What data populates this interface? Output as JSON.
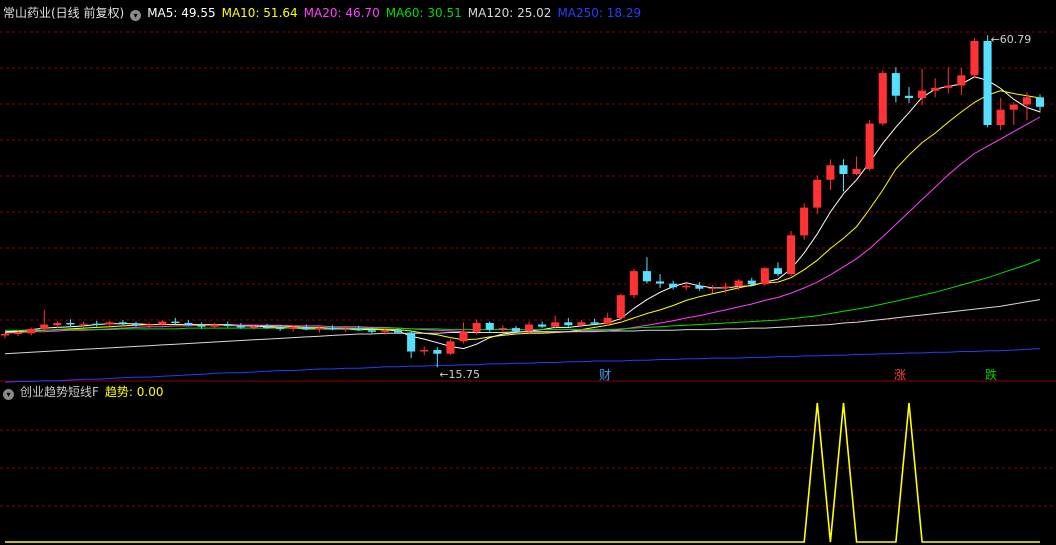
{
  "main_header": {
    "title": "常山药业(日线 前复权)",
    "ma_labels": [
      {
        "text": "MA5: 49.55",
        "color": "#ffffff"
      },
      {
        "text": "MA10: 51.64",
        "color": "#ffff00"
      },
      {
        "text": "MA20: 46.70",
        "color": "#ff40ff"
      },
      {
        "text": "MA60: 30.51",
        "color": "#00e000"
      },
      {
        "text": "MA120: 25.02",
        "color": "#d8d8d8"
      },
      {
        "text": "MA250: 18.29",
        "color": "#2a3cff"
      }
    ]
  },
  "annotations": {
    "high_label": "60.79",
    "low_label": "15.75"
  },
  "event_tags": [
    {
      "text": "财",
      "color": "#3aa0ff"
    },
    {
      "text": "涨",
      "color": "#ff4040"
    },
    {
      "text": "跌",
      "color": "#00d000"
    }
  ],
  "sub_header": {
    "title": "创业趋势短线F",
    "indicator_label": "趋势",
    "indicator_value": ": 0.00"
  },
  "colors": {
    "up": "#ff3333",
    "down": "#55e0ff",
    "grid": "#8b0000",
    "indicator": "#ffff00",
    "background": "#000000"
  },
  "chart_data": {
    "type": "candlestick",
    "price_range": [
      14,
      63
    ],
    "candles": [
      [
        20.1,
        20.5,
        19.7,
        20.3
      ],
      [
        20.3,
        20.8,
        20.0,
        20.5
      ],
      [
        20.4,
        21.2,
        20.1,
        21.0
      ],
      [
        21.0,
        23.6,
        20.8,
        21.6
      ],
      [
        21.5,
        22.0,
        21.1,
        21.8
      ],
      [
        21.8,
        22.3,
        21.4,
        21.6
      ],
      [
        21.6,
        22.0,
        21.2,
        21.7
      ],
      [
        21.7,
        22.1,
        21.3,
        21.6
      ],
      [
        21.6,
        22.1,
        21.3,
        21.9
      ],
      [
        21.9,
        22.2,
        21.5,
        21.7
      ],
      [
        21.7,
        22.0,
        21.3,
        21.5
      ],
      [
        21.5,
        21.9,
        21.1,
        21.6
      ],
      [
        21.6,
        22.2,
        21.4,
        22.0
      ],
      [
        22.0,
        22.5,
        21.6,
        21.8
      ],
      [
        21.8,
        22.2,
        21.4,
        21.5
      ],
      [
        21.5,
        21.9,
        21.0,
        21.3
      ],
      [
        21.3,
        21.8,
        21.0,
        21.6
      ],
      [
        21.6,
        22.0,
        21.2,
        21.4
      ],
      [
        21.4,
        21.8,
        21.0,
        21.2
      ],
      [
        21.2,
        21.6,
        20.9,
        21.3
      ],
      [
        21.3,
        21.7,
        21.0,
        21.1
      ],
      [
        21.1,
        21.5,
        20.7,
        21.0
      ],
      [
        21.0,
        21.4,
        20.6,
        21.2
      ],
      [
        21.2,
        21.6,
        20.8,
        20.9
      ],
      [
        20.9,
        21.3,
        20.5,
        21.1
      ],
      [
        21.1,
        21.5,
        20.8,
        20.9
      ],
      [
        20.9,
        21.3,
        20.6,
        21.0
      ],
      [
        21.0,
        21.4,
        20.7,
        20.8
      ],
      [
        20.8,
        21.2,
        20.4,
        20.6
      ],
      [
        20.6,
        21.0,
        20.2,
        20.8
      ],
      [
        20.8,
        21.1,
        20.4,
        20.5
      ],
      [
        20.5,
        20.7,
        17.0,
        17.9
      ],
      [
        17.9,
        18.6,
        17.4,
        18.1
      ],
      [
        18.1,
        18.5,
        15.75,
        17.6
      ],
      [
        17.6,
        19.6,
        17.4,
        19.3
      ],
      [
        19.3,
        21.9,
        19.0,
        20.6
      ],
      [
        20.6,
        22.3,
        20.2,
        21.8
      ],
      [
        21.8,
        22.0,
        20.6,
        20.9
      ],
      [
        20.9,
        21.5,
        20.5,
        21.1
      ],
      [
        21.1,
        21.4,
        20.5,
        20.7
      ],
      [
        20.7,
        22.0,
        20.4,
        21.6
      ],
      [
        21.6,
        22.0,
        21.1,
        21.3
      ],
      [
        21.3,
        22.8,
        21.0,
        21.9
      ],
      [
        21.9,
        22.5,
        21.3,
        21.5
      ],
      [
        21.5,
        22.2,
        21.2,
        21.9
      ],
      [
        21.9,
        22.4,
        21.5,
        21.7
      ],
      [
        21.7,
        23.2,
        21.4,
        22.5
      ],
      [
        22.5,
        25.8,
        22.2,
        25.6
      ],
      [
        25.6,
        29.2,
        25.2,
        28.9
      ],
      [
        28.9,
        30.8,
        27.2,
        27.5
      ],
      [
        27.5,
        28.5,
        26.6,
        27.2
      ],
      [
        27.2,
        27.6,
        26.4,
        26.7
      ],
      [
        26.7,
        27.3,
        26.3,
        26.9
      ],
      [
        26.9,
        27.4,
        26.2,
        26.5
      ],
      [
        26.5,
        27.0,
        25.9,
        26.6
      ],
      [
        26.6,
        27.3,
        25.9,
        26.8
      ],
      [
        26.8,
        27.8,
        26.3,
        27.6
      ],
      [
        27.6,
        28.0,
        26.9,
        27.1
      ],
      [
        27.1,
        29.5,
        26.9,
        29.3
      ],
      [
        29.3,
        30.1,
        28.2,
        28.5
      ],
      [
        28.5,
        34.4,
        28.2,
        33.8
      ],
      [
        33.8,
        38.2,
        33.2,
        37.6
      ],
      [
        37.6,
        42.0,
        36.7,
        41.4
      ],
      [
        41.4,
        44.2,
        40.0,
        43.4
      ],
      [
        43.4,
        44.2,
        39.8,
        42.2
      ],
      [
        42.2,
        44.6,
        42.0,
        42.9
      ],
      [
        42.9,
        49.6,
        42.6,
        49.1
      ],
      [
        49.1,
        56.4,
        48.8,
        56.0
      ],
      [
        56.0,
        56.8,
        52.0,
        52.9
      ],
      [
        52.9,
        54.1,
        51.9,
        52.6
      ],
      [
        52.6,
        56.6,
        51.6,
        53.6
      ],
      [
        53.6,
        55.3,
        52.7,
        54.0
      ],
      [
        54.0,
        56.8,
        53.2,
        54.3
      ],
      [
        54.3,
        56.7,
        53.0,
        55.7
      ],
      [
        55.7,
        60.79,
        55.3,
        60.4
      ],
      [
        60.4,
        61.2,
        48.6,
        48.9
      ],
      [
        48.9,
        52.6,
        48.2,
        51.0
      ],
      [
        51.0,
        52.0,
        48.9,
        51.7
      ],
      [
        51.7,
        53.4,
        49.6,
        52.7
      ],
      [
        52.7,
        53.1,
        50.6,
        51.4
      ]
    ],
    "ma_lines": [
      {
        "name": "MA5",
        "color": "#ffffff",
        "values": [
          20.6,
          20.7,
          20.9,
          21.1,
          21.2,
          21.3,
          21.4,
          21.6,
          21.7,
          21.7,
          21.7,
          21.6,
          21.6,
          21.6,
          21.6,
          21.6,
          21.6,
          21.5,
          21.4,
          21.4,
          21.3,
          21.2,
          21.1,
          21.0,
          21.0,
          21.0,
          21.0,
          20.9,
          20.9,
          20.9,
          20.7,
          20.0,
          19.6,
          19.1,
          18.6,
          18.3,
          18.9,
          19.8,
          20.3,
          20.5,
          20.7,
          20.9,
          21.2,
          21.2,
          21.4,
          21.6,
          21.8,
          22.4,
          23.8,
          25.0,
          26.0,
          26.8,
          27.3,
          26.9,
          26.6,
          26.6,
          26.8,
          26.9,
          27.4,
          27.8,
          29.2,
          31.4,
          34.0,
          37.0,
          39.5,
          41.4,
          43.8,
          46.4,
          48.6,
          50.6,
          52.7,
          53.8,
          54.2,
          54.5,
          55.5,
          55.0,
          53.9,
          52.4,
          51.3,
          50.7
        ]
      },
      {
        "name": "MA10",
        "color": "#ffff00",
        "values": [
          20.5,
          20.6,
          20.7,
          20.8,
          20.9,
          21.0,
          21.1,
          21.2,
          21.3,
          21.4,
          21.5,
          21.6,
          21.6,
          21.6,
          21.6,
          21.6,
          21.6,
          21.6,
          21.5,
          21.5,
          21.4,
          21.4,
          21.3,
          21.2,
          21.2,
          21.1,
          21.1,
          21.0,
          21.0,
          20.9,
          20.9,
          20.7,
          20.4,
          20.2,
          19.8,
          19.5,
          19.6,
          19.9,
          20.1,
          20.3,
          20.4,
          20.4,
          20.5,
          20.6,
          20.9,
          21.2,
          21.5,
          21.9,
          22.5,
          23.1,
          23.6,
          24.2,
          24.9,
          25.4,
          25.8,
          26.2,
          26.6,
          27.0,
          27.3,
          27.4,
          28.0,
          29.1,
          30.4,
          32.0,
          33.4,
          35.0,
          37.4,
          40.0,
          42.9,
          44.8,
          46.5,
          47.8,
          49.3,
          50.7,
          52.0,
          53.0,
          53.6,
          53.2,
          52.9,
          52.6
        ]
      },
      {
        "name": "MA20",
        "color": "#ff40ff",
        "values": [
          20.4,
          20.5,
          20.6,
          20.6,
          20.7,
          20.8,
          20.8,
          20.9,
          21.0,
          21.1,
          21.2,
          21.3,
          21.3,
          21.4,
          21.4,
          21.5,
          21.5,
          21.5,
          21.5,
          21.5,
          21.5,
          21.5,
          21.4,
          21.4,
          21.4,
          21.3,
          21.3,
          21.3,
          21.2,
          21.2,
          21.1,
          21.0,
          20.9,
          20.8,
          20.7,
          20.6,
          20.5,
          20.5,
          20.5,
          20.6,
          20.6,
          20.6,
          20.6,
          20.6,
          20.6,
          20.6,
          20.7,
          20.9,
          21.2,
          21.5,
          21.8,
          22.1,
          22.5,
          22.8,
          23.2,
          23.6,
          24.0,
          24.4,
          24.9,
          25.3,
          25.9,
          26.6,
          27.4,
          28.4,
          29.5,
          30.6,
          32.0,
          33.6,
          35.3,
          37.0,
          38.7,
          40.4,
          42.1,
          43.6,
          45.0,
          46.0,
          47.0,
          48.0,
          49.0,
          50.0
        ]
      },
      {
        "name": "MA60",
        "color": "#00e000",
        "values": [
          20.8,
          20.8,
          20.8,
          20.8,
          20.9,
          20.9,
          20.9,
          20.9,
          20.9,
          21.0,
          21.0,
          21.0,
          21.0,
          21.0,
          21.1,
          21.1,
          21.1,
          21.1,
          21.1,
          21.1,
          21.1,
          21.1,
          21.1,
          21.1,
          21.1,
          21.1,
          21.1,
          21.1,
          21.1,
          21.1,
          21.1,
          21.0,
          21.0,
          21.0,
          20.9,
          20.9,
          20.9,
          20.9,
          20.9,
          20.9,
          20.9,
          20.9,
          20.9,
          20.9,
          20.9,
          20.9,
          20.9,
          21.0,
          21.1,
          21.2,
          21.3,
          21.4,
          21.5,
          21.6,
          21.7,
          21.8,
          21.9,
          22.0,
          22.1,
          22.2,
          22.4,
          22.6,
          22.8,
          23.1,
          23.4,
          23.7,
          24.0,
          24.4,
          24.8,
          25.2,
          25.6,
          26.0,
          26.5,
          27.0,
          27.5,
          28.0,
          28.6,
          29.2,
          29.8,
          30.5
        ]
      },
      {
        "name": "MA120",
        "color": "#d8d8d8",
        "values": [
          17.6,
          17.7,
          17.8,
          17.9,
          18.0,
          18.1,
          18.2,
          18.3,
          18.4,
          18.5,
          18.6,
          18.7,
          18.8,
          18.9,
          19.0,
          19.1,
          19.2,
          19.3,
          19.4,
          19.5,
          19.6,
          19.7,
          19.8,
          19.9,
          20.0,
          20.1,
          20.2,
          20.3,
          20.3,
          20.4,
          20.4,
          20.4,
          20.4,
          20.4,
          20.5,
          20.5,
          20.5,
          20.5,
          20.5,
          20.6,
          20.6,
          20.6,
          20.6,
          20.6,
          20.7,
          20.7,
          20.7,
          20.7,
          20.7,
          20.8,
          20.8,
          20.8,
          20.9,
          20.9,
          20.9,
          21.0,
          21.0,
          21.1,
          21.1,
          21.2,
          21.3,
          21.4,
          21.5,
          21.6,
          21.8,
          21.9,
          22.1,
          22.3,
          22.5,
          22.7,
          22.9,
          23.1,
          23.3,
          23.5,
          23.7,
          23.9,
          24.1,
          24.4,
          24.7,
          25.0
        ]
      },
      {
        "name": "MA250",
        "color": "#2a3cff",
        "values": [
          13.7,
          13.8,
          13.8,
          13.9,
          13.9,
          14.0,
          14.1,
          14.1,
          14.2,
          14.3,
          14.4,
          14.4,
          14.5,
          14.6,
          14.7,
          14.8,
          14.9,
          15.0,
          15.0,
          15.1,
          15.2,
          15.3,
          15.3,
          15.4,
          15.5,
          15.5,
          15.6,
          15.6,
          15.7,
          15.8,
          15.8,
          15.9,
          15.9,
          16.0,
          16.0,
          16.1,
          16.1,
          16.2,
          16.2,
          16.3,
          16.3,
          16.4,
          16.4,
          16.5,
          16.5,
          16.6,
          16.6,
          16.6,
          16.7,
          16.7,
          16.8,
          16.8,
          16.9,
          16.9,
          17.0,
          17.0,
          17.0,
          17.1,
          17.1,
          17.2,
          17.2,
          17.3,
          17.3,
          17.4,
          17.4,
          17.5,
          17.5,
          17.6,
          17.6,
          17.7,
          17.7,
          17.8,
          17.8,
          17.9,
          17.9,
          18.0,
          18.0,
          18.1,
          18.2,
          18.3
        ]
      }
    ],
    "indicator": {
      "name": "趋势",
      "range": [
        0,
        1
      ],
      "values": [
        0,
        0,
        0,
        0,
        0,
        0,
        0,
        0,
        0,
        0,
        0,
        0,
        0,
        0,
        0,
        0,
        0,
        0,
        0,
        0,
        0,
        0,
        0,
        0,
        0,
        0,
        0,
        0,
        0,
        0,
        0,
        0,
        0,
        0,
        0,
        0,
        0,
        0,
        0,
        0,
        0,
        0,
        0,
        0,
        0,
        0,
        0,
        0,
        0,
        0,
        0,
        0,
        0,
        0,
        0,
        0,
        0,
        0,
        0,
        0,
        0,
        0,
        1,
        0,
        1,
        0,
        0,
        0,
        0,
        1,
        0,
        0,
        0,
        0,
        0,
        0,
        0,
        0,
        0,
        0
      ]
    }
  }
}
